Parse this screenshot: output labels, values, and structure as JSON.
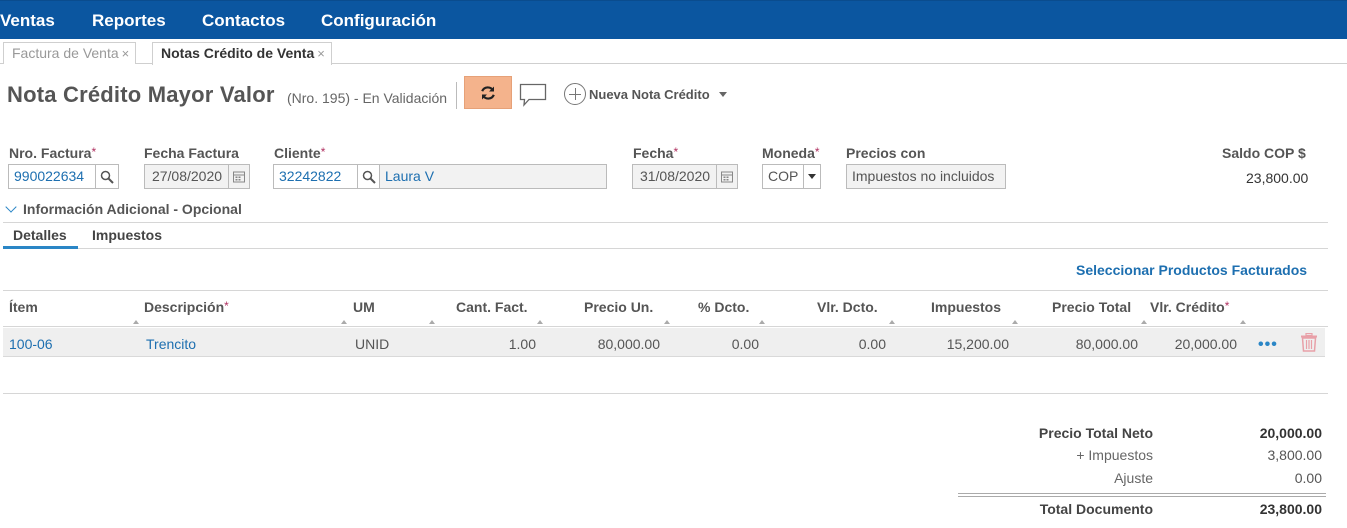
{
  "nav": {
    "items": [
      "Ventas",
      "Reportes",
      "Contactos",
      "Configuración"
    ]
  },
  "tabs": [
    {
      "label": "Factura de Venta",
      "close": "×"
    },
    {
      "label": "Notas Crédito de Venta",
      "close": "×"
    }
  ],
  "header": {
    "title": "Nota Crédito Mayor Valor",
    "subtitle": "(Nro. 195) - En Validación",
    "new_label": "Nueva Nota Crédito"
  },
  "form": {
    "nro_factura_label": "Nro. Factura",
    "nro_factura_value": "990022634",
    "fecha_factura_label": "Fecha Factura",
    "fecha_factura_value": "27/08/2020",
    "cliente_label": "Cliente",
    "cliente_id": "32242822",
    "cliente_name": "Laura V",
    "fecha_label": "Fecha",
    "fecha_value": "31/08/2020",
    "moneda_label": "Moneda",
    "moneda_value": "COP",
    "precios_label": "Precios con",
    "precios_value": "Impuestos no incluidos",
    "saldo_label": "Saldo COP $",
    "saldo_value": "23,800.00",
    "required_mark": "*"
  },
  "additional_info": "Información Adicional - Opcional",
  "detail_tabs": [
    "Detalles",
    "Impuestos"
  ],
  "select_products": "Seleccionar Productos Facturados",
  "table": {
    "headers": [
      "Ítem",
      "Descripción",
      "UM",
      "Cant. Fact.",
      "Precio Un.",
      "% Dcto.",
      "Vlr. Dcto.",
      "Impuestos",
      "Precio Total",
      "Vlr. Crédito"
    ],
    "rows": [
      [
        "100-06",
        "Trencito",
        "UNID",
        "1.00",
        "80,000.00",
        "0.00",
        "0.00",
        "15,200.00",
        "80,000.00",
        "20,000.00"
      ]
    ],
    "row_menu": "•••"
  },
  "totals": {
    "neto_label": "Precio Total Neto",
    "neto_value": "20,000.00",
    "impuestos_label": "+ Impuestos",
    "impuestos_value": "3,800.00",
    "ajuste_label": "Ajuste",
    "ajuste_value": "0.00",
    "total_label": "Total Documento",
    "total_value": "23,800.00"
  },
  "colors": {
    "nav_bg": "#0b56a0",
    "refresh_bg": "#f4b38c",
    "link": "#1d6fb0",
    "accent": "#2a86c6",
    "trash": "#e8a0a8"
  }
}
